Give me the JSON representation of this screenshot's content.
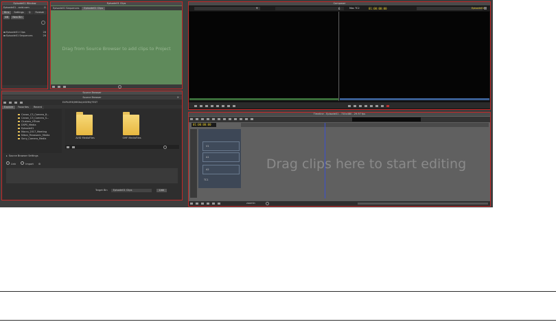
{
  "project_panel": {
    "title": "Episode01 Window",
    "project_name": "Episode01 - avid.com",
    "top_tabs": [
      "Bins",
      "Settings",
      "Q",
      "Format"
    ],
    "filter_buttons": [
      "NB",
      "New Bin"
    ],
    "bins": [
      {
        "name": "Episode01 Clips",
        "count": "26"
      },
      {
        "name": "Episode01 Sequences",
        "count": "26"
      }
    ]
  },
  "clips_bin": {
    "title": "Episode01 Clips",
    "tabs": [
      "Episode01 Sequences",
      "Episode01 Clips"
    ],
    "placeholder": "Drag from Source Browser to add clips to Project"
  },
  "composer": {
    "title": "Composer",
    "tc_left": "6",
    "tc_label": "Mas TC2",
    "tc_value": "01:00:00:00",
    "seq_name": "Episode01"
  },
  "source_browser": {
    "window_title": "Source Browser",
    "title": "Source Browser",
    "tabs": [
      "Explore",
      "Favorites",
      "Recent"
    ],
    "path": "EXPLORE/MEDIA/USERS/TEST",
    "tree": [
      "Canon_C3_Camera_8...",
      "Canon_C3_Camera_S...",
      "Clusters_HTrom",
      "DSPS_Media",
      "Episode01",
      "Macro_2017_Meeting",
      "Nikon_Panasonic_Media",
      "Sony_Camera_Media"
    ],
    "folders": [
      "AVID MediaFiles",
      "OMF MediaFiles"
    ],
    "settings_label": "Source Browser Settings",
    "link_label": "Link",
    "import_label": "Import",
    "target_bin_label": "Target Bin",
    "target_bin_value": "Episode01 Clips",
    "link_button": "Link"
  },
  "timeline": {
    "title": "Timeline - Episode01 - 720x480 - 29.97 fps",
    "timecode": "01:00:00:00",
    "tracks": [
      "V1",
      "A1",
      "A2",
      "TC1"
    ],
    "placeholder": "Drag clips here to start editing",
    "zoom_label": "zoomIn"
  }
}
